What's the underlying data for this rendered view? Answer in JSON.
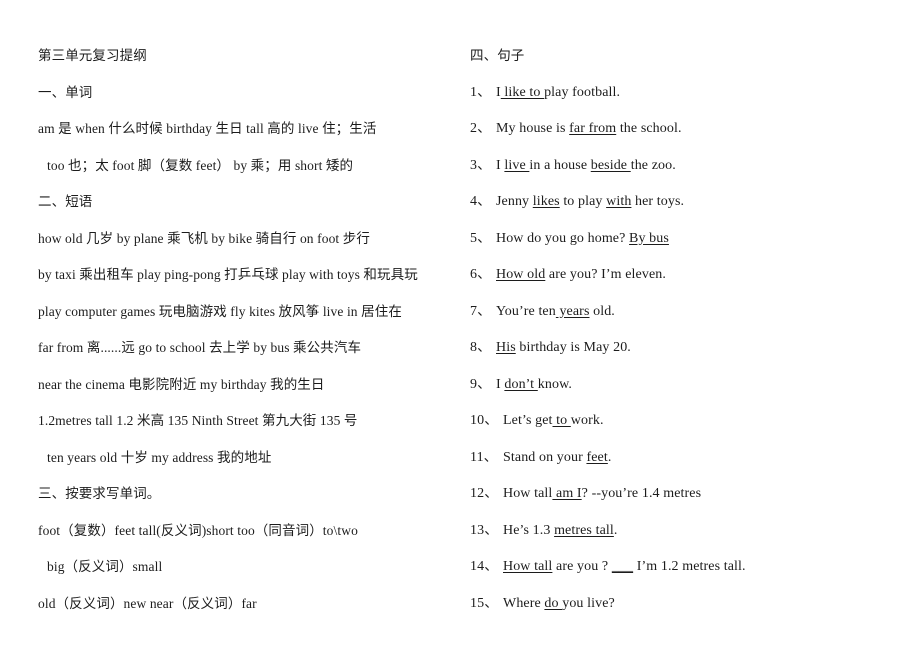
{
  "document": {
    "title": "第三单元复习提纲"
  },
  "left_column": {
    "sections": [
      {
        "heading": "一、单词"
      },
      {
        "heading": "二、短语"
      },
      {
        "heading": "三、按要求写单词。"
      }
    ],
    "lines": [
      {
        "id": "doc-title",
        "text": "第三单元复习提纲",
        "indent": false
      },
      {
        "id": "heading-words",
        "text": "一、单词",
        "indent": false
      },
      {
        "id": "words-1",
        "text": "am  是  when  什么时候   birthday  生日  tall  高的   live  住；生活",
        "indent": false
      },
      {
        "id": "words-2",
        "text": "too  也；太  foot  脚（复数 feet）     by 乘；用   short 矮的",
        "indent": true
      },
      {
        "id": "heading-phrases",
        "text": "二、短语",
        "indent": false
      },
      {
        "id": "phrases-1",
        "text": "how old  几岁  by plane  乘飞机   by bike  骑自行    on foot  步行",
        "indent": false
      },
      {
        "id": "phrases-2",
        "text": "by taxi  乘出租车   play ping-pong 打乒乓球     play with toys  和玩具玩",
        "indent": false
      },
      {
        "id": "phrases-3",
        "text": "play computer games  玩电脑游戏    fly kites  放风筝   live in  居住在",
        "indent": false
      },
      {
        "id": "phrases-4",
        "text": "far from  离......远        go to school  去上学   by bus  乘公共汽车",
        "indent": false
      },
      {
        "id": "phrases-5",
        "text": "near the cinema  电影院附近  my birthday  我的生日",
        "indent": false
      },
      {
        "id": "phrases-6",
        "text": "1.2metres tall 1.2 米高 135 Ninth Street  第九大街 135 号",
        "indent": false
      },
      {
        "id": "phrases-7",
        "text": "ten years old  十岁    my address  我的地址",
        "indent": true
      },
      {
        "id": "heading-wordforms",
        "text": "三、按要求写单词。",
        "indent": false
      },
      {
        "id": "wordforms-1",
        "text": "foot（复数）feet   tall(反义词)short   too（同音词）to\\two",
        "indent": false
      },
      {
        "id": "wordforms-2",
        "text": "big（反义词）small",
        "indent": true
      },
      {
        "id": "wordforms-3",
        "text": "old（反义词）new   near（反义词）far",
        "indent": false
      }
    ]
  },
  "right_column": {
    "heading": "四、句子",
    "sentences": [
      {
        "number": "1、",
        "parts": [
          {
            "text": "I",
            "underline": false
          },
          {
            "text": " like to ",
            "underline": true
          },
          {
            "text": "play football.",
            "underline": false
          }
        ],
        "plain": "1、I like to play football."
      },
      {
        "number": "2、",
        "parts": [
          {
            "text": "My house is ",
            "underline": false
          },
          {
            "text": "far from",
            "underline": true
          },
          {
            "text": " the school.",
            "underline": false
          }
        ],
        "plain": "2、My house is far from the school."
      },
      {
        "number": "3、",
        "parts": [
          {
            "text": "I ",
            "underline": false
          },
          {
            "text": "live ",
            "underline": true
          },
          {
            "text": "in a house ",
            "underline": false
          },
          {
            "text": "beside ",
            "underline": true
          },
          {
            "text": "the zoo.",
            "underline": false
          }
        ],
        "plain": "3、I live in a house beside the zoo."
      },
      {
        "number": "4、",
        "parts": [
          {
            "text": "Jenny ",
            "underline": false
          },
          {
            "text": "likes",
            "underline": true
          },
          {
            "text": " to play ",
            "underline": false
          },
          {
            "text": "with",
            "underline": true
          },
          {
            "text": " her toys.",
            "underline": false
          }
        ],
        "plain": "4、Jenny likes to play with her toys."
      },
      {
        "number": "5、",
        "parts": [
          {
            "text": "How do you go home?   ",
            "underline": false
          },
          {
            "text": "By bus",
            "underline": true
          }
        ],
        "plain": "5、How do you go home?   By bus"
      },
      {
        "number": "6、",
        "parts": [
          {
            "text": "How old",
            "underline": true
          },
          {
            "text": " are you?   I’m eleven.",
            "underline": false
          }
        ],
        "plain": "6、How old are you?   I’m eleven."
      },
      {
        "number": "7、",
        "parts": [
          {
            "text": "You’re ten",
            "underline": false
          },
          {
            "text": " years",
            "underline": true
          },
          {
            "text": " old.",
            "underline": false
          }
        ],
        "plain": "7、You’re ten years old."
      },
      {
        "number": "8、",
        "parts": [
          {
            "text": "His",
            "underline": true
          },
          {
            "text": " birthday is May 20.",
            "underline": false
          }
        ],
        "plain": "8、His birthday is May 20."
      },
      {
        "number": "9、",
        "parts": [
          {
            "text": "I ",
            "underline": false
          },
          {
            "text": "don’t ",
            "underline": true
          },
          {
            "text": "know.",
            "underline": false
          }
        ],
        "plain": "9、I don’t know."
      },
      {
        "number": "10、",
        "parts": [
          {
            "text": "Let’s get",
            "underline": false
          },
          {
            "text": " to ",
            "underline": true
          },
          {
            "text": "work.",
            "underline": false
          }
        ],
        "plain": "10、Let’s get to work."
      },
      {
        "number": "11、",
        "parts": [
          {
            "text": "Stand on your ",
            "underline": false
          },
          {
            "text": "feet",
            "underline": true
          },
          {
            "text": ".",
            "underline": false
          }
        ],
        "plain": "11、Stand on your feet."
      },
      {
        "number": "12、",
        "parts": [
          {
            "text": "How tall",
            "underline": false
          },
          {
            "text": " am I",
            "underline": true
          },
          {
            "text": "? --you’re 1.4 metres",
            "underline": false
          }
        ],
        "plain": "12、How tall am I? --you’re 1.4 metres"
      },
      {
        "number": "13、",
        "parts": [
          {
            "text": "He’s 1.3 ",
            "underline": false
          },
          {
            "text": "metres tall",
            "underline": true
          },
          {
            "text": ".",
            "underline": false
          }
        ],
        "plain": "13、He’s 1.3 metres tall."
      },
      {
        "number": "14、",
        "parts": [
          {
            "text": "How tall",
            "underline": true
          },
          {
            "text": " are you ? ",
            "underline": false
          },
          {
            "text": "___",
            "underline": true
          },
          {
            "text": " I’m 1.2 metres tall.",
            "underline": false
          }
        ],
        "plain": "14、How tall are you ? ___ I’m 1.2 metres tall."
      },
      {
        "number": "15、",
        "parts": [
          {
            "text": "Where ",
            "underline": false
          },
          {
            "text": "do ",
            "underline": true
          },
          {
            "text": "you live?",
            "underline": false
          }
        ],
        "plain": "15、Where do you live?"
      }
    ]
  },
  "colors": {
    "page_background": "#ffffff",
    "text": "#1c1c1c"
  }
}
